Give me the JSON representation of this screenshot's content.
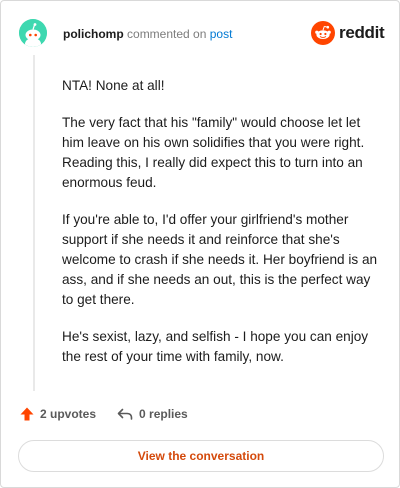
{
  "brand": {
    "wordmark": "reddit",
    "logo_icon": "reddit-snoo-icon",
    "accent_color": "#ff4500",
    "link_color": "#0079d3",
    "cta_color": "#d44a0c"
  },
  "header": {
    "username": "polichomp",
    "action": "commented on",
    "post_link": "post",
    "avatar_icon": "snoo-avatar-icon",
    "avatar_color": "#3ed8b0"
  },
  "comment": {
    "paragraphs": [
      "NTA! None at all!",
      "The very fact that his \"family\" would choose let let him leave on his own solidifies that you were right. Reading this, I really did expect this to turn into an enormous feud.",
      "If you're able to, I'd offer your girlfriend's mother support if she needs it and reinforce that she's welcome to crash if she needs it. Her boyfriend is an ass, and if she needs an out, this is the perfect way to get there.",
      "He's sexist, lazy, and selfish - I hope you can enjoy the rest of your time with family, now."
    ]
  },
  "footer": {
    "upvotes": "2 upvotes",
    "upvote_icon": "upvote-arrow-icon",
    "replies": "0 replies",
    "reply_icon": "reply-arrow-icon"
  },
  "cta": {
    "label": "View the conversation"
  }
}
